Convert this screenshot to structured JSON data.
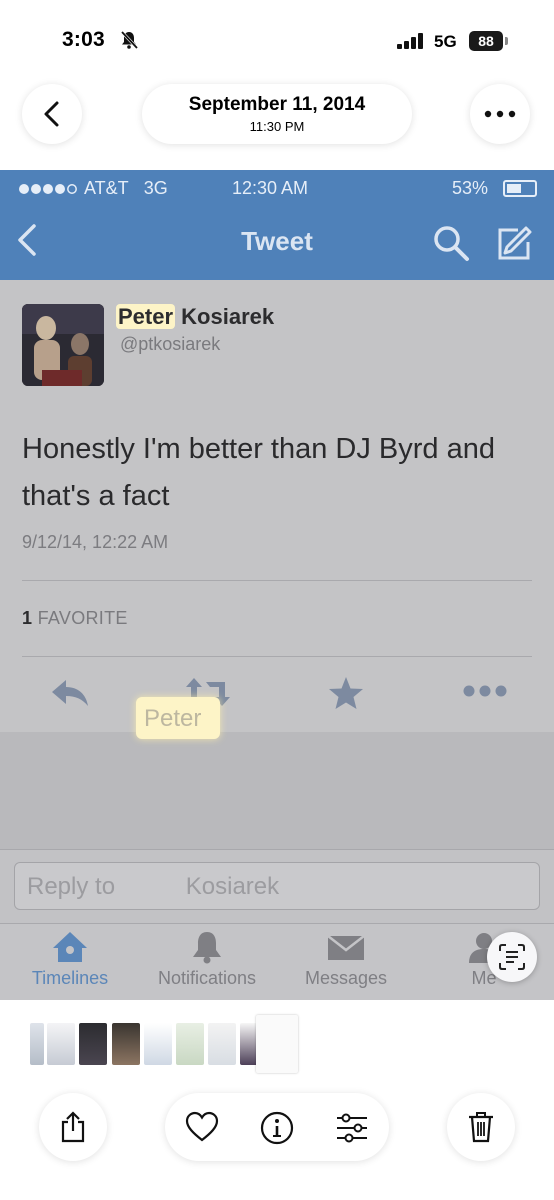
{
  "ios_status": {
    "time": "3:03",
    "network": "5G",
    "battery": "88"
  },
  "header": {
    "date": "September 11, 2014",
    "time": "11:30 PM"
  },
  "screenshot": {
    "status": {
      "carrier": "AT&T",
      "network": "3G",
      "time": "12:30 AM",
      "battery": "53%"
    },
    "navbar": {
      "title": "Tweet"
    },
    "tweet": {
      "author_first": "Peter",
      "author_last": " Kosiarek",
      "handle": "@ptkosiarek",
      "text": "Honestly I'm better than DJ Byrd and that's a fact",
      "timestamp": "9/12/14, 12:22 AM",
      "favorite_count": "1",
      "favorite_label": " FAVORITE"
    },
    "reply": {
      "prefix": "Reply to ",
      "highlight": "Peter",
      "suffix": " Kosiarek"
    },
    "tabs": [
      {
        "label": "Timelines"
      },
      {
        "label": "Notifications"
      },
      {
        "label": "Messages"
      },
      {
        "label": "Me"
      }
    ]
  },
  "colors": {
    "twitter_blue": "#4f81b9",
    "highlight": "#fdf4c7",
    "screenshot_bg": "#c4c4c6"
  }
}
